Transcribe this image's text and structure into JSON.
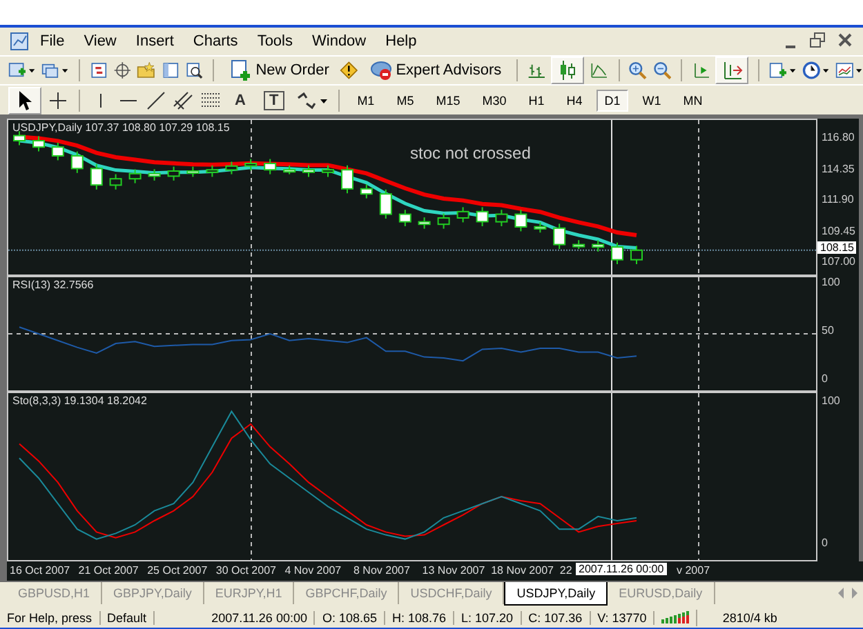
{
  "menu": [
    "File",
    "View",
    "Insert",
    "Charts",
    "Tools",
    "Window",
    "Help"
  ],
  "toolbar": {
    "new_order": "New Order",
    "expert_advisors": "Expert Advisors"
  },
  "drawing_tools": [
    "A",
    "T"
  ],
  "timeframes": [
    {
      "label": "M1",
      "selected": false
    },
    {
      "label": "M5",
      "selected": false
    },
    {
      "label": "M15",
      "selected": false
    },
    {
      "label": "M30",
      "selected": false
    },
    {
      "label": "H1",
      "selected": false
    },
    {
      "label": "H4",
      "selected": false
    },
    {
      "label": "D1",
      "selected": true
    },
    {
      "label": "W1",
      "selected": false
    },
    {
      "label": "MN",
      "selected": false
    }
  ],
  "price_pane": {
    "label": "USDJPY,Daily  107.37 108.80 107.29 108.15",
    "annotation": "stoc not crossed",
    "ticks": [
      "116.80",
      "114.35",
      "111.90",
      "109.45",
      "107.00"
    ],
    "current_price": "108.15"
  },
  "rsi_pane": {
    "label": "RSI(13) 32.7566",
    "ticks": [
      "100",
      "50",
      "0"
    ]
  },
  "sto_pane": {
    "label": "Sto(8,3,3) 19.1304 18.2042",
    "ticks": [
      "100",
      "0"
    ]
  },
  "time_axis": {
    "dates": [
      "16 Oct 2007",
      "21 Oct 2007",
      "25 Oct 2007",
      "30 Oct 2007",
      "4 Nov 2007",
      "8 Nov 2007",
      "13 Nov 2007",
      "18 Nov 2007",
      "22"
    ],
    "crosshair_label": "2007.11.26 00:00",
    "tail": "v 2007"
  },
  "tabs": [
    {
      "label": "GBPUSD,H1",
      "selected": false
    },
    {
      "label": "GBPJPY,Daily",
      "selected": false
    },
    {
      "label": "EURJPY,H1",
      "selected": false
    },
    {
      "label": "GBPCHF,Daily",
      "selected": false
    },
    {
      "label": "USDCHF,Daily",
      "selected": false
    },
    {
      "label": "USDJPY,Daily",
      "selected": true
    },
    {
      "label": "EURUSD,Daily",
      "selected": false
    }
  ],
  "status_bar": [
    "For Help, press",
    "Default",
    "2007.11.26 00:00",
    "O: 108.65",
    "H: 108.76",
    "L: 107.20",
    "C: 107.36",
    "V: 13770",
    "2810/4 kb"
  ]
}
